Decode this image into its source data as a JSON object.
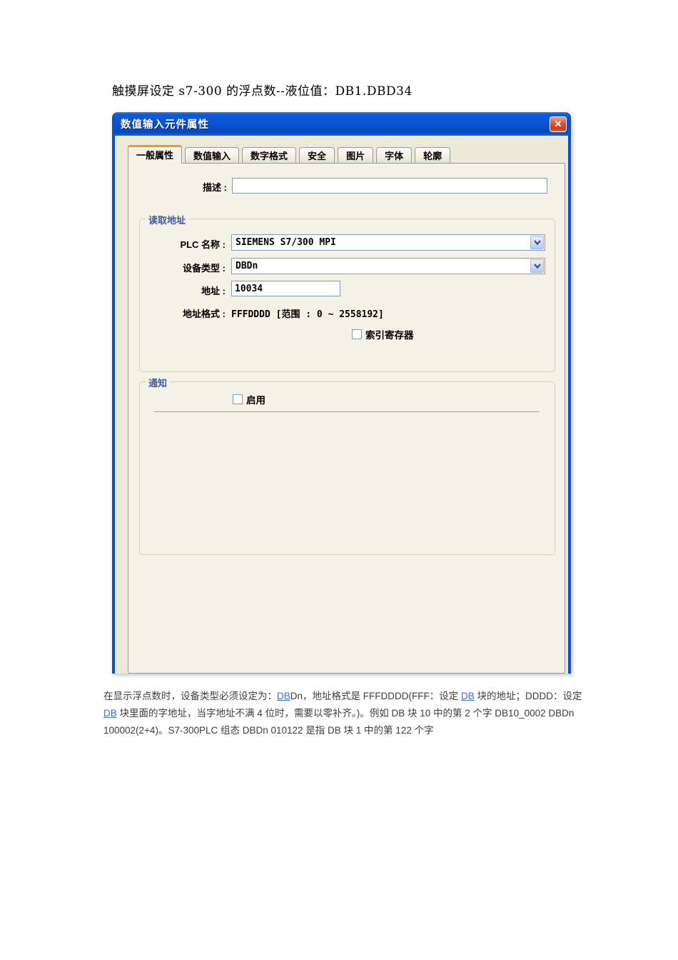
{
  "page": {
    "doc_title": "触摸屏设定 s7-300 的浮点数--液位值：DB1.DBD34"
  },
  "dialog": {
    "title": "数值输入元件属性",
    "tabs": [
      {
        "label": "一般属性",
        "active": true
      },
      {
        "label": "数值输入",
        "active": false
      },
      {
        "label": "数字格式",
        "active": false
      },
      {
        "label": "安全",
        "active": false
      },
      {
        "label": "图片",
        "active": false
      },
      {
        "label": "字体",
        "active": false
      },
      {
        "label": "轮廓",
        "active": false
      }
    ],
    "description": {
      "label": "描述 :",
      "value": ""
    },
    "read_address": {
      "group_title": "读取地址",
      "plc_name": {
        "label": "PLC 名称 :",
        "value": "SIEMENS S7/300 MPI"
      },
      "device_type": {
        "label": "设备类型 :",
        "value": "DBDn"
      },
      "address": {
        "label": "地址 :",
        "value": "10034"
      },
      "address_format": {
        "label": "地址格式 :",
        "value": "FFFDDDD [范围 : 0 ~ 2558192]"
      },
      "index_register": {
        "label": "索引寄存器",
        "checked": false
      }
    },
    "notification": {
      "group_title": "通知",
      "enable": {
        "label": "启用",
        "checked": false
      }
    }
  },
  "footer_note": {
    "segments": [
      {
        "text": "在显示浮点数时，设备类型必须设定为：",
        "link": false
      },
      {
        "text": "DB",
        "link": true
      },
      {
        "text": "Dn，地址格式是 FFFDDDD(FFF：设定 ",
        "link": false
      },
      {
        "text": "DB",
        "link": true
      },
      {
        "text": " 块的地址；DDDD：设定 ",
        "link": false
      },
      {
        "text": "DB",
        "link": true
      },
      {
        "text": " 块里面的字地址，当字地址不满 4 位时，需要以零补齐。)。例如 DB 块 10 中的第 2 个字 DB10_0002 DBDn 100002(2+4)。S7-300PLC 组态 DBDn 010122 是指 DB 块 1 中的第 122 个字",
        "link": false
      }
    ]
  },
  "icons": {
    "close_glyph": "✕"
  },
  "colors": {
    "titlebar_blue": "#0b55d4",
    "dialog_border_blue": "#0a50c8",
    "dialog_body": "#ECE9D8",
    "panel_bg": "#f4f1e6",
    "tab_accent_orange": "#e89b32",
    "close_button_red": "#c93c1d",
    "group_label_blue": "#4159a8",
    "input_border": "#7f9db9",
    "link_blue": "#3b6fc4"
  }
}
